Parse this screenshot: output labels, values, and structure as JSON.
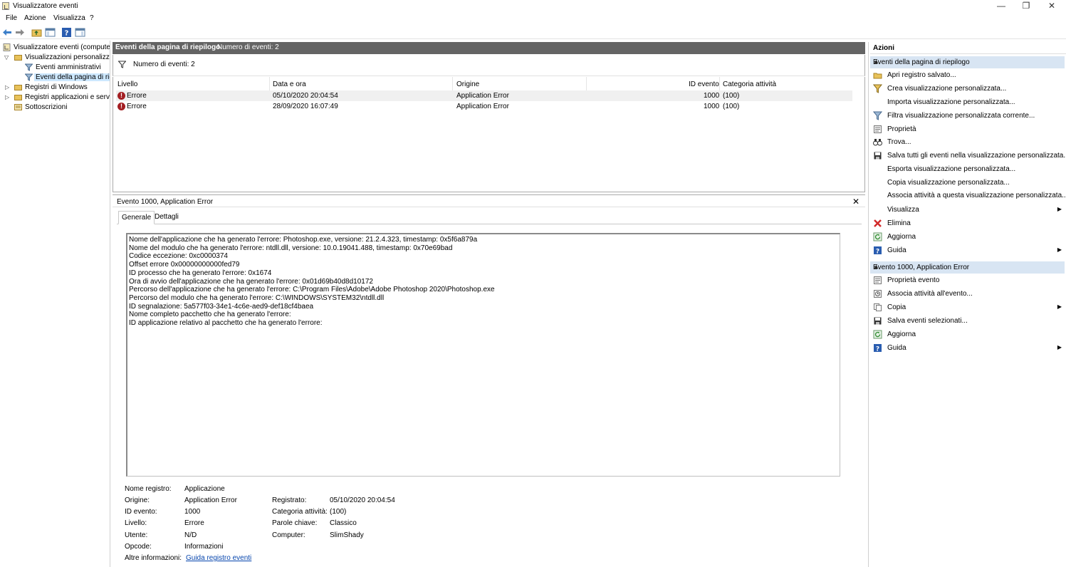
{
  "window": {
    "title": "Visualizzatore eventi",
    "minimize": "—",
    "maximize": "❐",
    "close": "✕"
  },
  "menu": [
    "File",
    "Azione",
    "Visualizza",
    "?"
  ],
  "tree": {
    "root": "Visualizzatore eventi (computer",
    "custom_views": "Visualizzazioni personalizzate",
    "admin_events": "Eventi amministrativi",
    "summary_events": "Eventi della pagina di riepilogo",
    "windows_logs": "Registri di Windows",
    "app_logs": "Registri applicazioni e servizi",
    "subscriptions": "Sottoscrizioni"
  },
  "center": {
    "header_title": "Eventi della pagina di riepilogo",
    "header_count": "Numero di eventi: 2",
    "filter_text": "Numero di eventi: 2",
    "columns": [
      "Livello",
      "Data e ora",
      "Origine",
      "ID evento",
      "Categoria attività"
    ],
    "rows": [
      {
        "level": "Errore",
        "date": "05/10/2020 20:04:54",
        "source": "Application Error",
        "id": "1000",
        "category": "(100)"
      },
      {
        "level": "Errore",
        "date": "28/09/2020 16:07:49",
        "source": "Application Error",
        "id": "1000",
        "category": "(100)"
      }
    ]
  },
  "detail": {
    "title": "Evento 1000, Application Error",
    "close": "✕",
    "tabs": [
      "Generale",
      "Dettagli"
    ],
    "description": [
      "Nome dell'applicazione che ha generato l'errore: Photoshop.exe, versione: 21.2.4.323, timestamp: 0x5f6a879a",
      "Nome del modulo che ha generato l'errore: ntdll.dll, versione: 10.0.19041.488, timestamp: 0x70e69bad",
      "Codice eccezione: 0xc0000374",
      "Offset errore 0x00000000000fed79",
      "ID processo che ha generato l'errore: 0x1674",
      "Ora di avvio dell'applicazione che ha generato l'errore: 0x01d69b40d8d10172",
      "Percorso dell'applicazione che ha generato l'errore: C:\\Program Files\\Adobe\\Adobe Photoshop 2020\\Photoshop.exe",
      "Percorso del modulo che ha generato l'errore: C:\\WINDOWS\\SYSTEM32\\ntdll.dll",
      "ID segnalazione: 5a577f03-34e1-4c6e-aed9-def18cf4baea",
      "Nome completo pacchetto che ha generato l'errore:",
      "ID applicazione relativo al pacchetto che ha generato l'errore:"
    ],
    "props": {
      "log_name_label": "Nome registro:",
      "log_name": "Applicazione",
      "source_label": "Origine:",
      "source": "Application Error",
      "logged_label": "Registrato:",
      "logged": "05/10/2020 20:04:54",
      "event_id_label": "ID evento:",
      "event_id": "1000",
      "task_label": "Categoria attività:",
      "task": "(100)",
      "level_label": "Livello:",
      "level": "Errore",
      "keywords_label": "Parole chiave:",
      "keywords": "Classico",
      "user_label": "Utente:",
      "user": "N/D",
      "computer_label": "Computer:",
      "computer": "SlimShady",
      "opcode_label": "Opcode:",
      "opcode": "Informazioni",
      "more_info_label": "Altre informazioni:",
      "more_info_link": "Guida registro eventi"
    }
  },
  "actions": {
    "title": "Azioni",
    "section1": "Eventi della pagina di riepilogo",
    "items1": [
      "Apri registro salvato...",
      "Crea visualizzazione personalizzata...",
      "Importa visualizzazione personalizzata...",
      "Filtra visualizzazione personalizzata corrente...",
      "Proprietà",
      "Trova...",
      "Salva tutti gli eventi nella visualizzazione personalizzata...",
      "Esporta visualizzazione personalizzata...",
      "Copia visualizzazione personalizzata...",
      "Associa attività a questa visualizzazione personalizzata...",
      "Visualizza",
      "Elimina",
      "Aggiorna",
      "Guida"
    ],
    "section2": "Evento 1000, Application Error",
    "items2": [
      "Proprietà evento",
      "Associa attività all'evento...",
      "Copia",
      "Salva eventi selezionati...",
      "Aggiorna",
      "Guida"
    ]
  }
}
